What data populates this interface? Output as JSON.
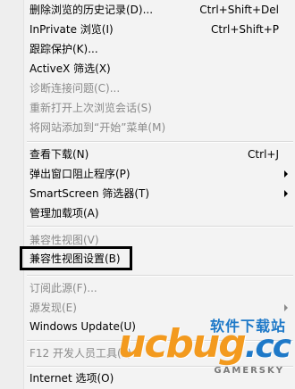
{
  "menu": {
    "items": [
      {
        "label": "删除浏览的历史记录(D)...",
        "accel": "Ctrl+Shift+Del"
      },
      {
        "label": "InPrivate 浏览(I)",
        "accel": "Ctrl+Shift+P"
      },
      {
        "label": "跟踪保护(K)..."
      },
      {
        "label": "ActiveX 筛选(X)"
      },
      {
        "label": "诊断连接问题(C)..."
      },
      {
        "label": "重新打开上次浏览会话(S)"
      },
      {
        "label": "将网站添加到“开始”菜单(M)"
      },
      {
        "label": "查看下载(N)",
        "accel": "Ctrl+J"
      },
      {
        "label": "弹出窗口阻止程序(P)"
      },
      {
        "label": "SmartScreen 筛选器(T)"
      },
      {
        "label": "管理加载项(A)"
      },
      {
        "label": "兼容性视图(V)"
      },
      {
        "label": "兼容性视图设置(B)"
      },
      {
        "label": "订阅此源(F)..."
      },
      {
        "label": "源发现(E)"
      },
      {
        "label": "Windows Update(U)"
      },
      {
        "label": "F12 开发人员工具(L)"
      },
      {
        "label": "Internet 选项(O)"
      }
    ]
  },
  "watermark": {
    "logo_main": "ucbug",
    "logo_suffix": ".cc",
    "cn_text": "软件下载站",
    "en_text": "GAMERSKY"
  },
  "colors": {
    "menu_bg": "#f3f3f3",
    "disabled_text": "#8a8a8a",
    "highlight_border": "#000000",
    "logo_orange": "#f39a1e",
    "logo_blue": "#1e79c8"
  }
}
